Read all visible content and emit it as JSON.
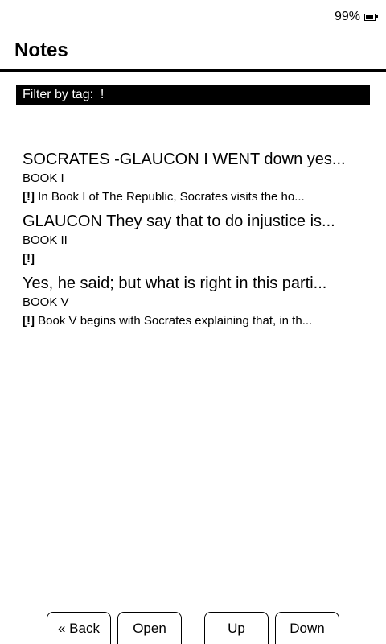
{
  "status": {
    "battery": "99%",
    "battery_icon": "battery-icon"
  },
  "header": {
    "title": "Notes"
  },
  "filter": {
    "label": "Filter by tag:  !"
  },
  "notes": [
    {
      "title": "SOCRATES -GLAUCON I WENT down yes...",
      "chapter": "BOOK I",
      "tag": "[!]",
      "text": " In Book I of The Republic, Socrates visits the ho..."
    },
    {
      "title": "GLAUCON They say that to do injustice is...",
      "chapter": "BOOK II",
      "tag": "[!]",
      "text": ""
    },
    {
      "title": "Yes, he said; but what is right in this parti...",
      "chapter": "BOOK V",
      "tag": "[!]",
      "text": " Book V begins with Socrates explaining that, in th..."
    }
  ],
  "buttons": {
    "back": "« Back",
    "open": "Open",
    "up": "Up",
    "down": "Down"
  }
}
